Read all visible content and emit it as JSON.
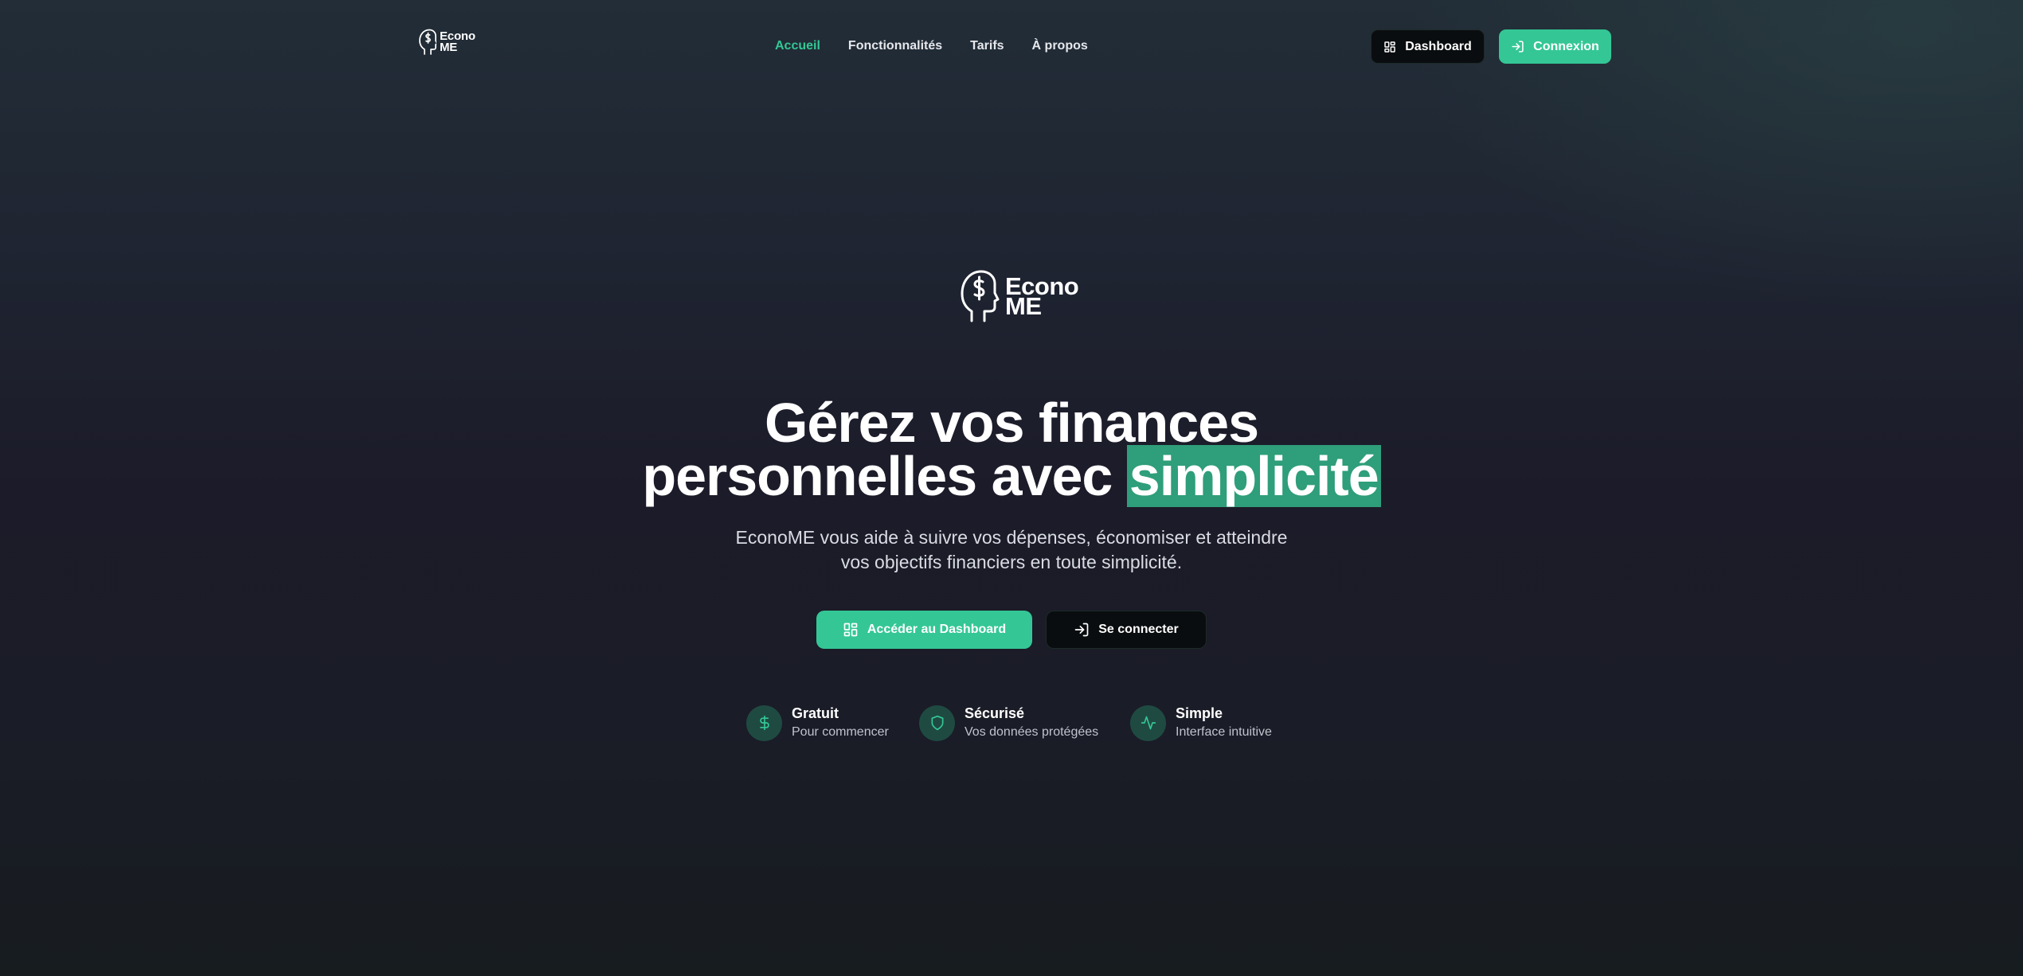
{
  "brand": {
    "name_line1": "Econo",
    "name_line2": "ME"
  },
  "nav": {
    "links": [
      {
        "label": "Accueil",
        "active": true
      },
      {
        "label": "Fonctionnalités",
        "active": false
      },
      {
        "label": "Tarifs",
        "active": false
      },
      {
        "label": "À propos",
        "active": false
      }
    ],
    "dashboard_label": "Dashboard",
    "login_label": "Connexion"
  },
  "hero": {
    "headline_line1": "Gérez vos finances",
    "headline_line2_prefix": "personnelles avec",
    "headline_highlight": "simplicité",
    "subtitle_line1": "EconoME vous aide à suivre vos dépenses, économiser et atteindre",
    "subtitle_line2": "vos objectifs financiers en toute simplicité.",
    "primary_cta": "Accéder au Dashboard",
    "secondary_cta": "Se connecter"
  },
  "features": [
    {
      "title": "Gratuit",
      "desc": "Pour commencer",
      "icon": "dollar-icon"
    },
    {
      "title": "Sécurisé",
      "desc": "Vos données protégées",
      "icon": "shield-icon"
    },
    {
      "title": "Simple",
      "desc": "Interface intuitive",
      "icon": "activity-icon"
    }
  ],
  "colors": {
    "accent": "#34c795",
    "highlight": "#2f9e7a",
    "dark_button": "#0a0d0f"
  }
}
